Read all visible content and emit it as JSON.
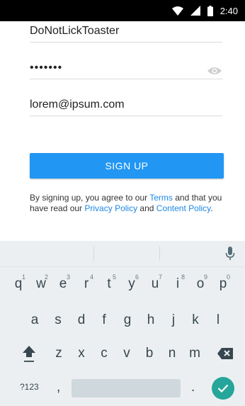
{
  "status_bar": {
    "time": "2:40",
    "icons": [
      "wifi-icon",
      "signal-icon",
      "battery-icon"
    ]
  },
  "form": {
    "username": {
      "value": "DoNotLickToaster"
    },
    "password": {
      "value": "•••••••"
    },
    "email": {
      "value": "lorem@ipsum.com"
    },
    "signup_label": "SIGN UP",
    "terms": {
      "p1": "By signing up, you agree to our ",
      "terms_link": "Terms",
      "p2": " and that you have read our ",
      "privacy_link": "Privacy Policy",
      "p3": " and ",
      "content_link": "Content Policy",
      "p4": "."
    }
  },
  "keyboard": {
    "row1": [
      {
        "label": "q",
        "hint": "1"
      },
      {
        "label": "w",
        "hint": "2"
      },
      {
        "label": "e",
        "hint": "3"
      },
      {
        "label": "r",
        "hint": "4"
      },
      {
        "label": "t",
        "hint": "5"
      },
      {
        "label": "y",
        "hint": "6"
      },
      {
        "label": "u",
        "hint": "7"
      },
      {
        "label": "i",
        "hint": "8"
      },
      {
        "label": "o",
        "hint": "9"
      },
      {
        "label": "p",
        "hint": "0"
      }
    ],
    "row2": [
      "a",
      "s",
      "d",
      "f",
      "g",
      "h",
      "j",
      "k",
      "l"
    ],
    "row3": [
      "z",
      "x",
      "c",
      "v",
      "b",
      "n",
      "m"
    ],
    "symbols_label": "?123",
    "comma_label": ",",
    "period_label": "."
  },
  "colors": {
    "accent": "#2196f3",
    "link": "#1e88e5",
    "done": "#26a69a",
    "keyboard_bg": "#eceff1"
  }
}
